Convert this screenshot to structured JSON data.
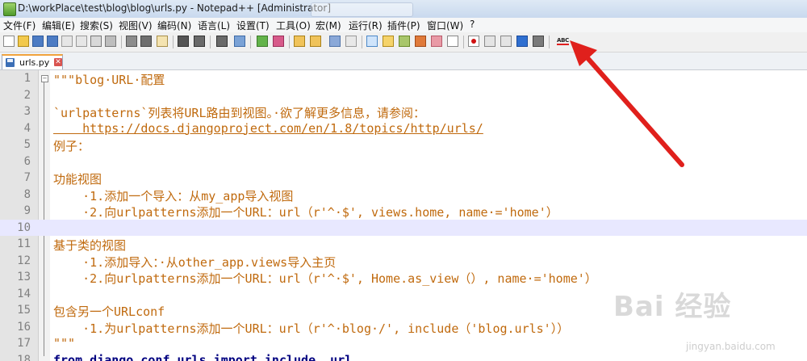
{
  "window": {
    "title": "D:\\workPlace\\test\\blog\\blog\\urls.py - Notepad++ [Administrator]"
  },
  "menu": [
    "文件(F)",
    "编辑(E)",
    "搜索(S)",
    "视图(V)",
    "编码(N)",
    "语言(L)",
    "设置(T)",
    "工具(O)",
    "宏(M)",
    "运行(R)",
    "插件(P)",
    "窗口(W)",
    "?"
  ],
  "toolbar": {
    "spellcheck_label": "ABC",
    "icons": [
      "new-file-icon",
      "open-file-icon",
      "save-icon",
      "save-all-icon",
      "close-icon",
      "close-all-icon",
      "print-icon",
      "cut-icon",
      "copy-icon",
      "paste-icon",
      "undo-icon",
      "redo-icon",
      "find-icon",
      "replace-icon",
      "zoom-in-icon",
      "zoom-out-icon",
      "sync-vertical-icon",
      "sync-horizontal-icon",
      "word-wrap-icon",
      "show-all-chars-icon",
      "indent-guide-icon",
      "user-language-icon",
      "doc-map-icon",
      "function-list-icon",
      "folder-as-workspace-icon",
      "monitor-icon",
      "record-macro-icon",
      "stop-record-icon",
      "play-macro-icon",
      "run-macro-multiple-icon",
      "save-macro-icon"
    ]
  },
  "tabs": [
    {
      "label": "urls.py",
      "active": true
    }
  ],
  "editor": {
    "current_line": 10,
    "lines": [
      {
        "n": "1",
        "text": "\"\"\"blog·URL·配置"
      },
      {
        "n": "2",
        "text": ""
      },
      {
        "n": "3",
        "text": "`urlpatterns`列表将URL路由到视图。·欲了解更多信息，请参阅："
      },
      {
        "n": "4",
        "text": "    https://docs.djangoproject.com/en/1.8/topics/http/urls/"
      },
      {
        "n": "5",
        "text": "例子："
      },
      {
        "n": "6",
        "text": ""
      },
      {
        "n": "7",
        "text": "功能视图"
      },
      {
        "n": "8",
        "text": "    ·1.添加一个导入：从my_app导入视图"
      },
      {
        "n": "9",
        "text": "    ·2.向urlpatterns添加一个URL：url（r'^·$', views.home, name·='home'）"
      },
      {
        "n": "10",
        "text": ""
      },
      {
        "n": "11",
        "text": "基于类的视图"
      },
      {
        "n": "12",
        "text": "    ·1.添加导入：·从other_app.views导入主页"
      },
      {
        "n": "13",
        "text": "    ·2.向urlpatterns添加一个URL：url（r'^·$', Home.as_view（）, name·='home'）"
      },
      {
        "n": "14",
        "text": ""
      },
      {
        "n": "15",
        "text": "包含另一个URLconf"
      },
      {
        "n": "16",
        "text": "    ·1.为urlpatterns添加一个URL：url（r'^·blog·/', include（'blog.urls'））"
      },
      {
        "n": "17",
        "text": "\"\"\""
      },
      {
        "n": "18",
        "text": "from django.conf.urls import include, url"
      }
    ]
  },
  "colors": {
    "string": "#c06a0e",
    "keyword": "#000080",
    "current_line": "#e8e8ff",
    "annotation_arrow": "#e0201c"
  },
  "watermark": {
    "main": "Bai 经验",
    "sub": "jingyan.baidu.com"
  }
}
